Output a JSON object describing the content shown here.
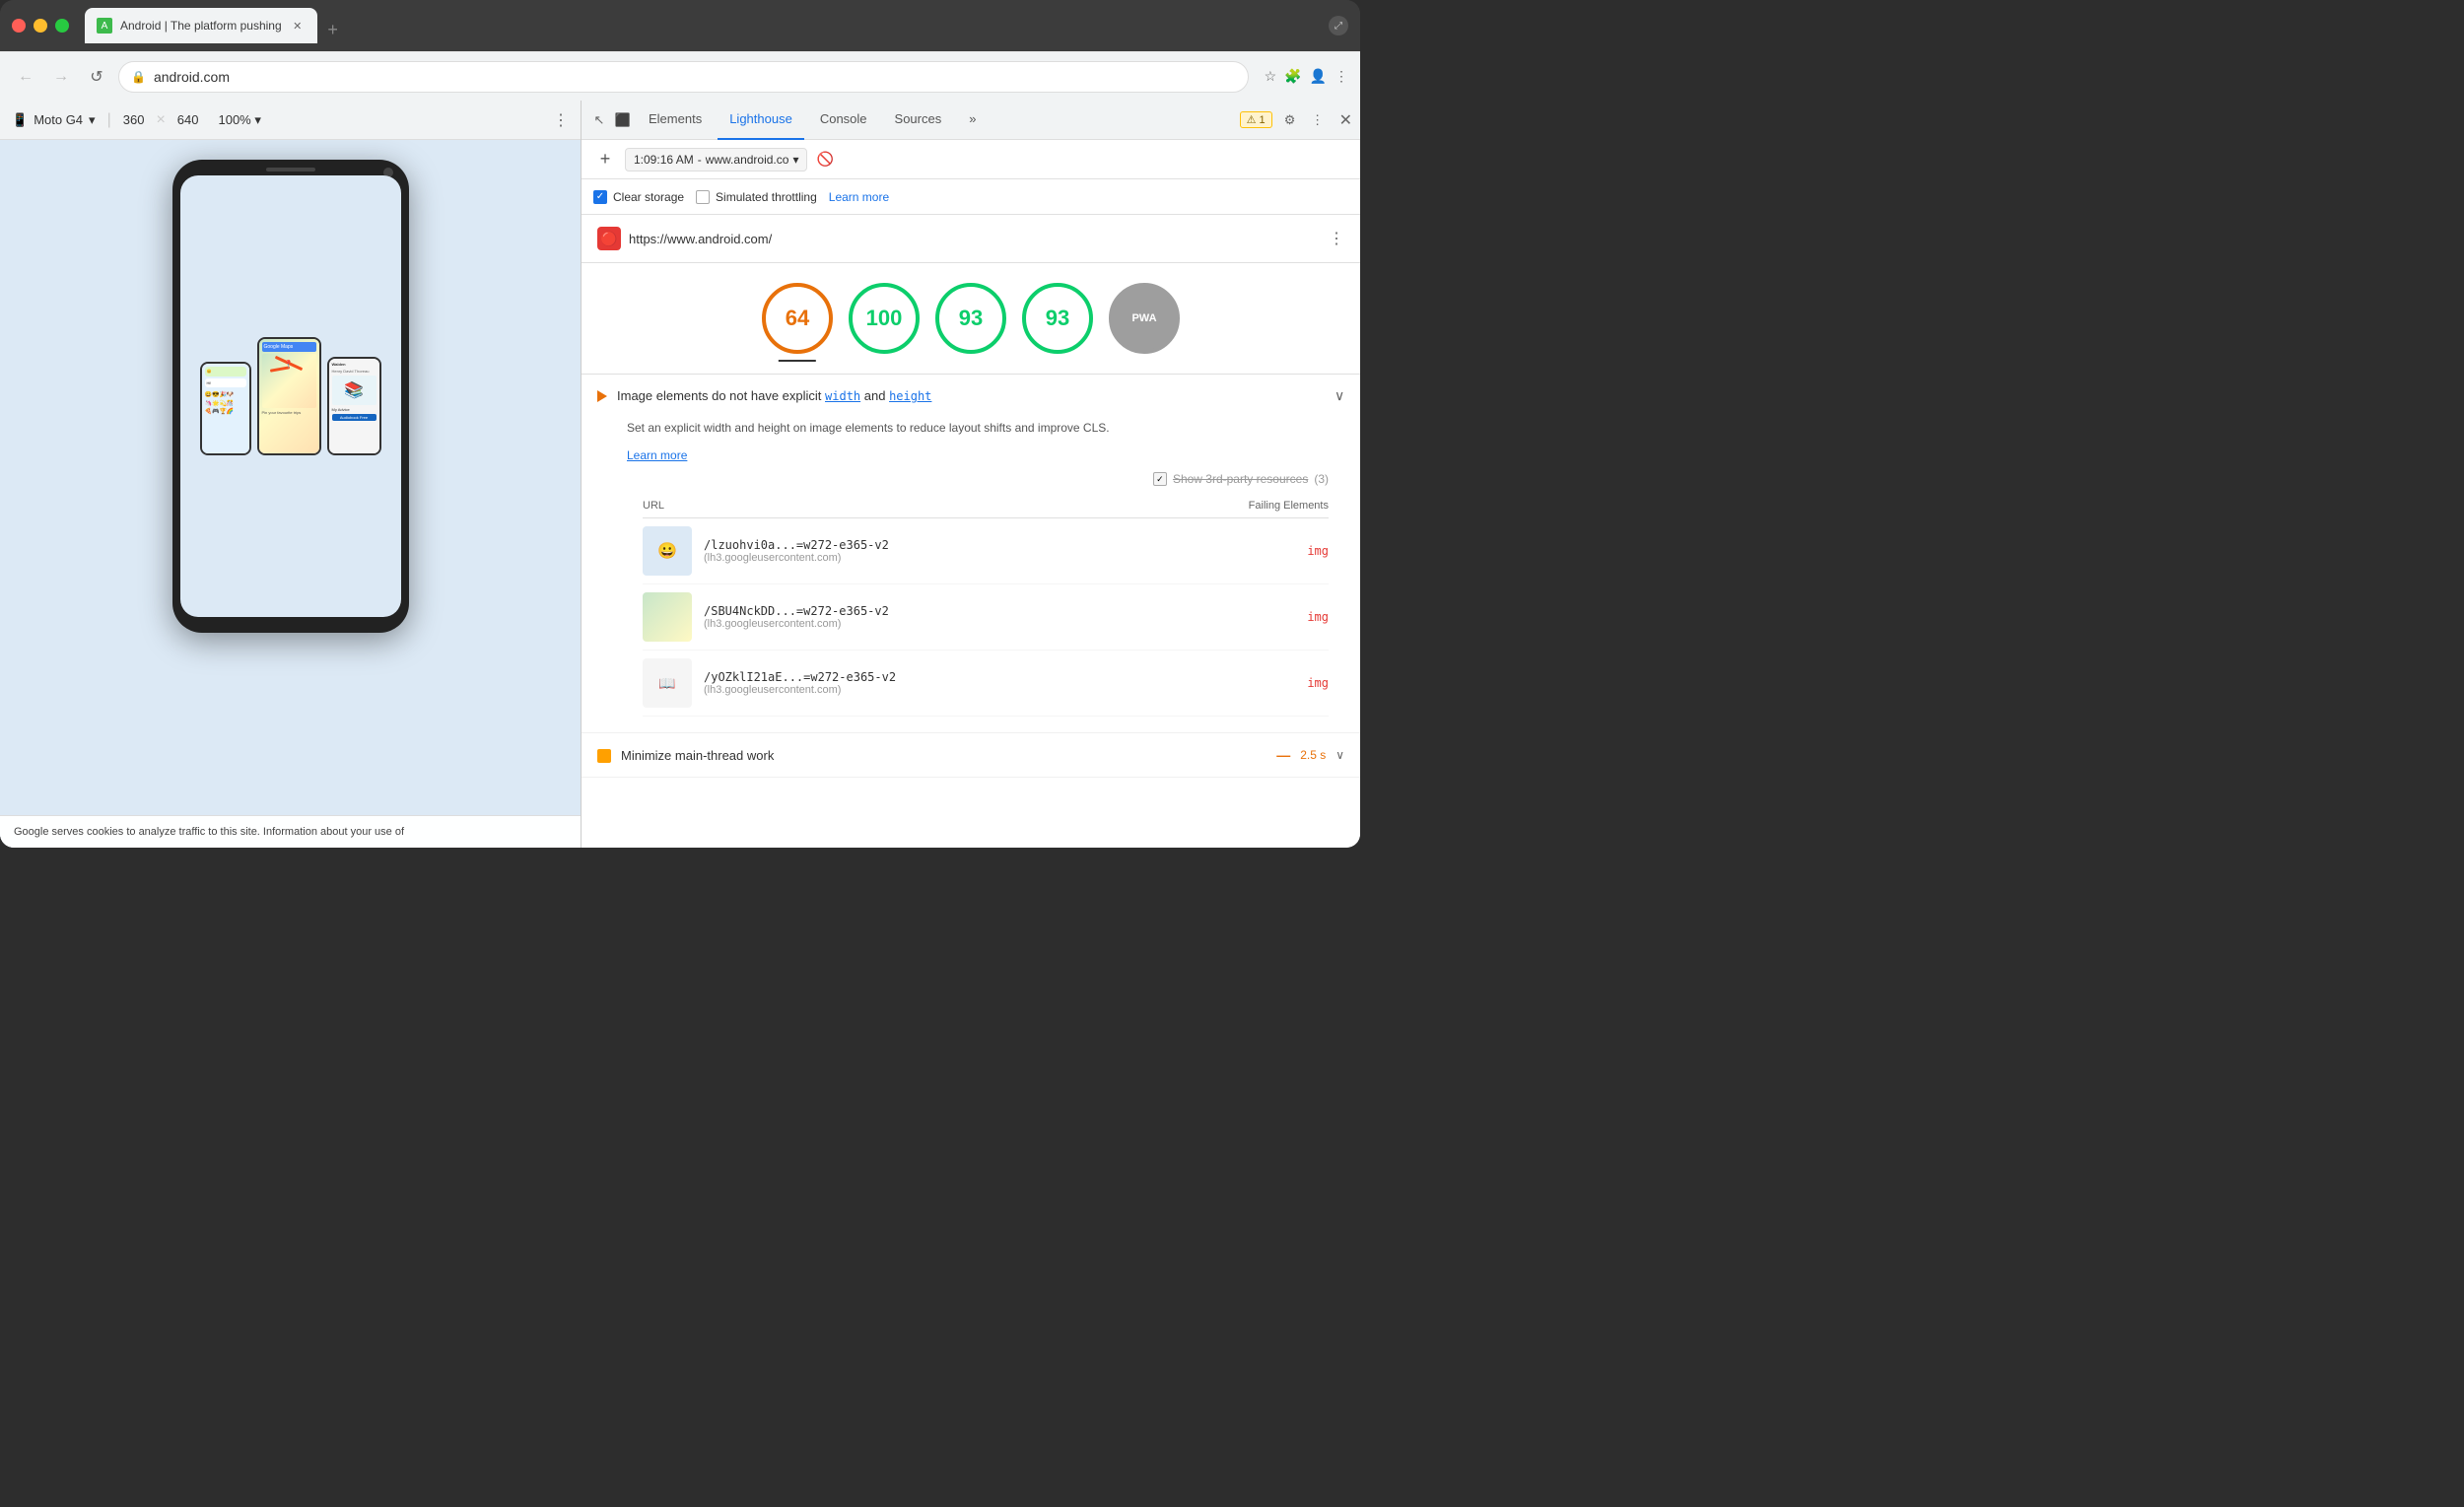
{
  "window": {
    "title": "Android | The platform pushing",
    "tab_title": "Android | The platform pushing",
    "favicon_color": "#3dba4c",
    "close_char": "✕",
    "add_tab_char": "+"
  },
  "address_bar": {
    "back_icon": "←",
    "forward_icon": "→",
    "reload_icon": "↺",
    "url": "android.com",
    "lock_icon": "🔒",
    "star_icon": "☆",
    "extensions_icon": "🧩",
    "profile_icon": "👤",
    "menu_icon": "⋮"
  },
  "viewport_toolbar": {
    "device_icon": "📱",
    "device_name": "Moto G4",
    "device_arrow": "▾",
    "width": "360",
    "x": "×",
    "height": "640",
    "zoom": "100%",
    "zoom_arrow": "▾",
    "menu_icon": "⋮"
  },
  "devtools": {
    "toolbar_icon1": "↖",
    "toolbar_icon2": "⬛",
    "tabs": [
      {
        "label": "Elements",
        "active": false
      },
      {
        "label": "Lighthouse",
        "active": true
      },
      {
        "label": "Console",
        "active": false
      },
      {
        "label": "Sources",
        "active": false
      }
    ],
    "more_tabs": "»",
    "warning_count": "1",
    "settings_icon": "⚙",
    "more_icon": "⋮",
    "close_icon": "✕"
  },
  "lighthouse": {
    "toolbar": {
      "add_icon": "+",
      "time": "1:09:16 AM",
      "separator": "-",
      "url": "www.android.co",
      "url_arrow": "▾",
      "clear_icon": "🚫"
    },
    "options": {
      "clear_storage_checked": true,
      "clear_storage_label": "Clear storage",
      "simulated_throttling_checked": false,
      "simulated_throttling_label": "Simulated throttling",
      "learn_more": "Learn more"
    },
    "report": {
      "icon_char": "🔴",
      "url": "https://www.android.com/",
      "menu_icon": "⋮",
      "scores": [
        {
          "value": "64",
          "color": "orange",
          "selected": true
        },
        {
          "value": "100",
          "color": "green",
          "selected": false
        },
        {
          "value": "93",
          "color": "green",
          "selected": false
        },
        {
          "value": "93",
          "color": "green",
          "selected": false
        },
        {
          "value": "PWA",
          "color": "gray",
          "selected": false
        }
      ]
    },
    "audit_image": {
      "icon": "▲",
      "icon_color": "#e8710a",
      "title_before": "Image elements do not have explicit ",
      "code1": "width",
      "text_and": " and ",
      "code2": "height",
      "expand_icon": "∧",
      "description": "Set an explicit width and height on image elements to reduce layout shifts and improve CLS.",
      "learn_more": "Learn more",
      "third_party_label": "Show 3rd-party resources",
      "third_party_count": "(3)",
      "table": {
        "col_url": "URL",
        "col_failing": "Failing Elements",
        "rows": [
          {
            "url_path": "/lzuohvi0a...=w272-e365-v2",
            "url_host": "(lh3.googleusercontent.com)",
            "failing": "img"
          },
          {
            "url_path": "/SBU4NckDD...=w272-e365-v2",
            "url_host": "(lh3.googleusercontent.com)",
            "failing": "img"
          },
          {
            "url_path": "/yOZklI21aE...=w272-e365-v2",
            "url_host": "(lh3.googleusercontent.com)",
            "failing": "img"
          }
        ]
      }
    },
    "audit_minimize": {
      "icon": "—",
      "icon_color": "#ffa000",
      "title": "Minimize main-thread work",
      "dash": "—",
      "time": "2.5 s",
      "expand_icon": "∨"
    }
  },
  "page_content": {
    "cookie_text": "Google serves cookies to analyze traffic to this site. Information about your use of"
  }
}
